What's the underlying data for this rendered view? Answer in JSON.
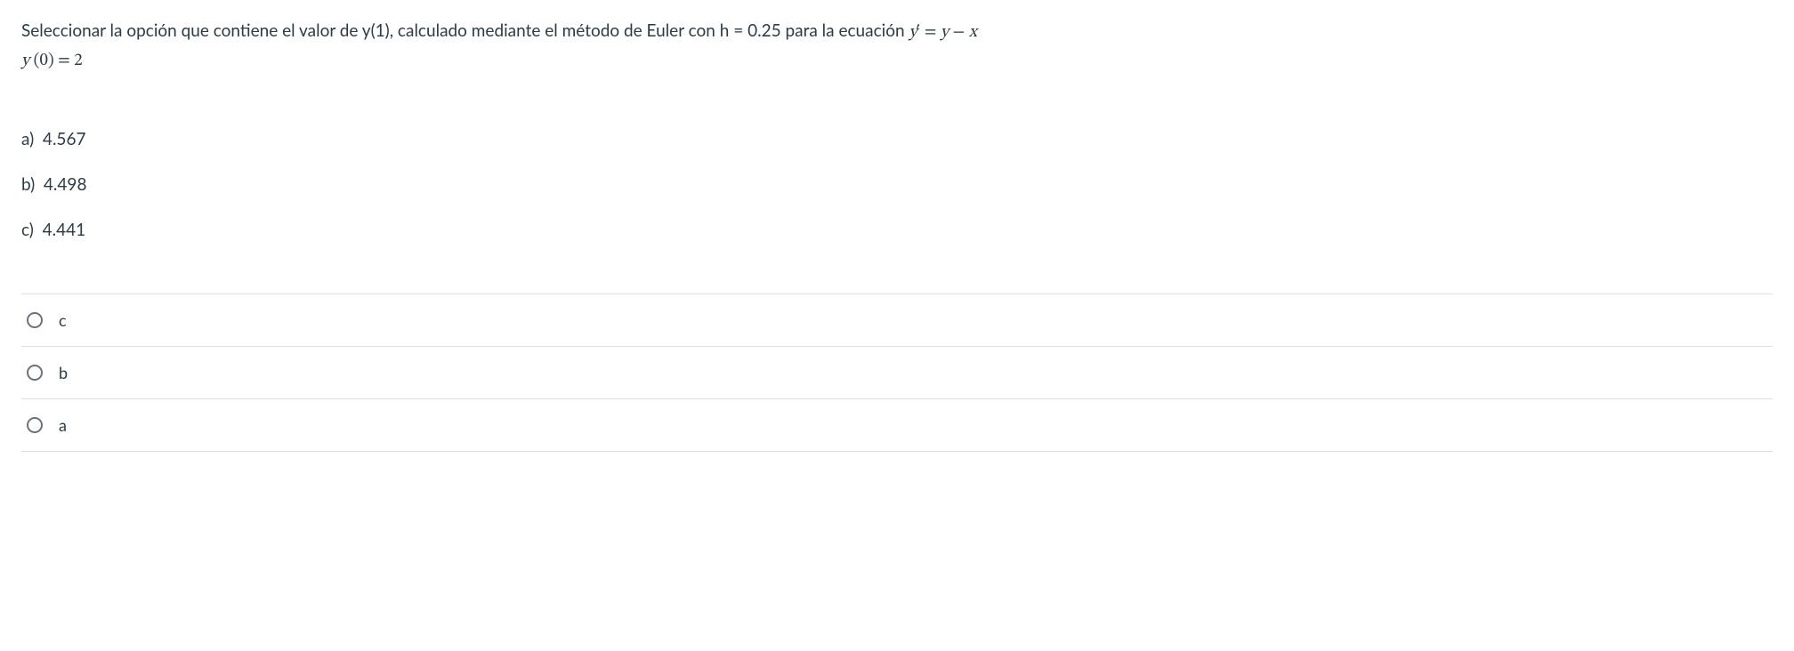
{
  "question": {
    "text_part1": "Seleccionar la opción que contiene el valor de y(1), calculado mediante el método de Euler con h = 0.25 para la ecuación  ",
    "equation1_lhs": "y",
    "equation1_prime": "′",
    "equation1_eq": " = ",
    "equation1_rhs_y": "y",
    "equation1_minus": " − ",
    "equation1_rhs_x": "x",
    "equation2_y": "y",
    "equation2_paren_open": " (",
    "equation2_zero": "0",
    "equation2_paren_close": ") ",
    "equation2_eq": "= ",
    "equation2_val": "2"
  },
  "options": [
    {
      "letter": "a)",
      "value": "4.567"
    },
    {
      "letter": "b)",
      "value": "4.498"
    },
    {
      "letter": "c)",
      "value": "4.441"
    }
  ],
  "answers": [
    {
      "label": "c"
    },
    {
      "label": "b"
    },
    {
      "label": "a"
    }
  ]
}
